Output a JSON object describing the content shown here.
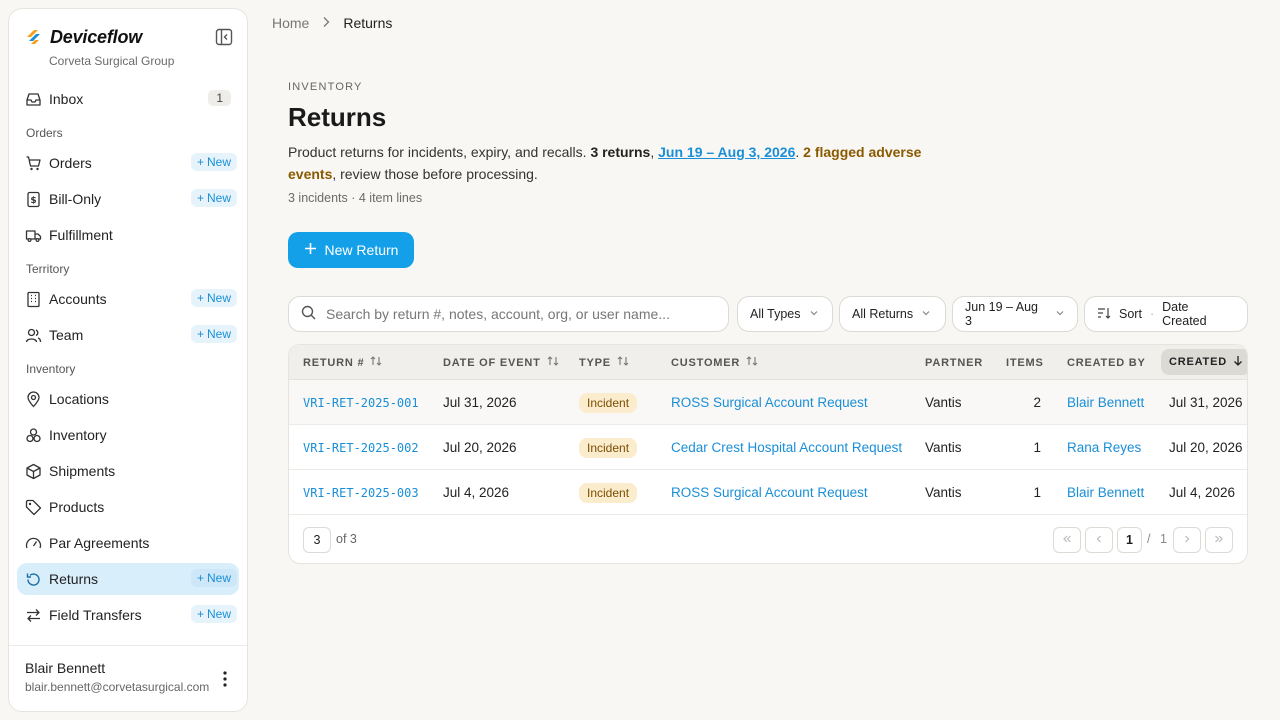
{
  "brand": {
    "name": "Deviceflow",
    "org": "Corveta Surgical Group"
  },
  "sidebar": {
    "inbox": {
      "label": "Inbox",
      "count": "1"
    },
    "sections": {
      "orders": "Orders",
      "territory": "Territory",
      "inventory": "Inventory"
    },
    "items": {
      "orders": "Orders",
      "bill_only": "Bill-Only",
      "fulfillment": "Fulfillment",
      "accounts": "Accounts",
      "team": "Team",
      "locations": "Locations",
      "inventory": "Inventory",
      "shipments": "Shipments",
      "products": "Products",
      "par_agreements": "Par Agreements",
      "returns": "Returns",
      "field_transfers": "Field Transfers"
    },
    "new_label": "New"
  },
  "user": {
    "name": "Blair Bennett",
    "email": "blair.bennett@corvetasurgical.com"
  },
  "breadcrumb": {
    "home": "Home",
    "current": "Returns"
  },
  "header": {
    "eyebrow": "INVENTORY",
    "title": "Returns",
    "desc_prefix": "Product returns for incidents, expiry, and recalls. ",
    "desc_count": "3 returns",
    "desc_sep": ", ",
    "desc_range": "Jun 19 – Aug 3, 2026",
    "desc_dot": ". ",
    "desc_flag": "2 flagged adverse events",
    "desc_suffix": ", review those before processing.",
    "meta": "3 incidents · 4 item lines"
  },
  "new_return_label": "New Return",
  "search": {
    "placeholder": "Search by return #, notes, account, org, or user name..."
  },
  "filters": {
    "types": "All Types",
    "returns": "All Returns",
    "dates": "Jun 19 – Aug 3",
    "sort": "Sort",
    "sort_value": "Date Created"
  },
  "table": {
    "headers": {
      "return_no": "RETURN #",
      "date_of_event": "DATE OF EVENT",
      "type": "TYPE",
      "customer": "CUSTOMER",
      "partner": "PARTNER",
      "items": "ITEMS",
      "created_by": "CREATED BY",
      "created": "CREATED"
    },
    "rows": [
      {
        "id": "VRI-RET-2025-001",
        "date": "Jul 31, 2026",
        "type": "Incident",
        "customer": "ROSS Surgical Account Request",
        "partner": "Vantis",
        "items": "2",
        "created_by": "Blair Bennett",
        "created": "Jul 31, 2026"
      },
      {
        "id": "VRI-RET-2025-002",
        "date": "Jul 20, 2026",
        "type": "Incident",
        "customer": "Cedar Crest Hospital Account Request",
        "partner": "Vantis",
        "items": "1",
        "created_by": "Rana Reyes",
        "created": "Jul 20, 2026"
      },
      {
        "id": "VRI-RET-2025-003",
        "date": "Jul 4, 2026",
        "type": "Incident",
        "customer": "ROSS Surgical Account Request",
        "partner": "Vantis",
        "items": "1",
        "created_by": "Blair Bennett",
        "created": "Jul 4, 2026"
      }
    ],
    "footer": {
      "page_size": "3",
      "of_total": "of 3",
      "page": "1",
      "page_sep": "/",
      "total_pages": "1"
    }
  },
  "colors": {
    "accent": "#14a0e8",
    "active_bg": "#d8eefb",
    "incident_bg": "#fbeccd"
  }
}
